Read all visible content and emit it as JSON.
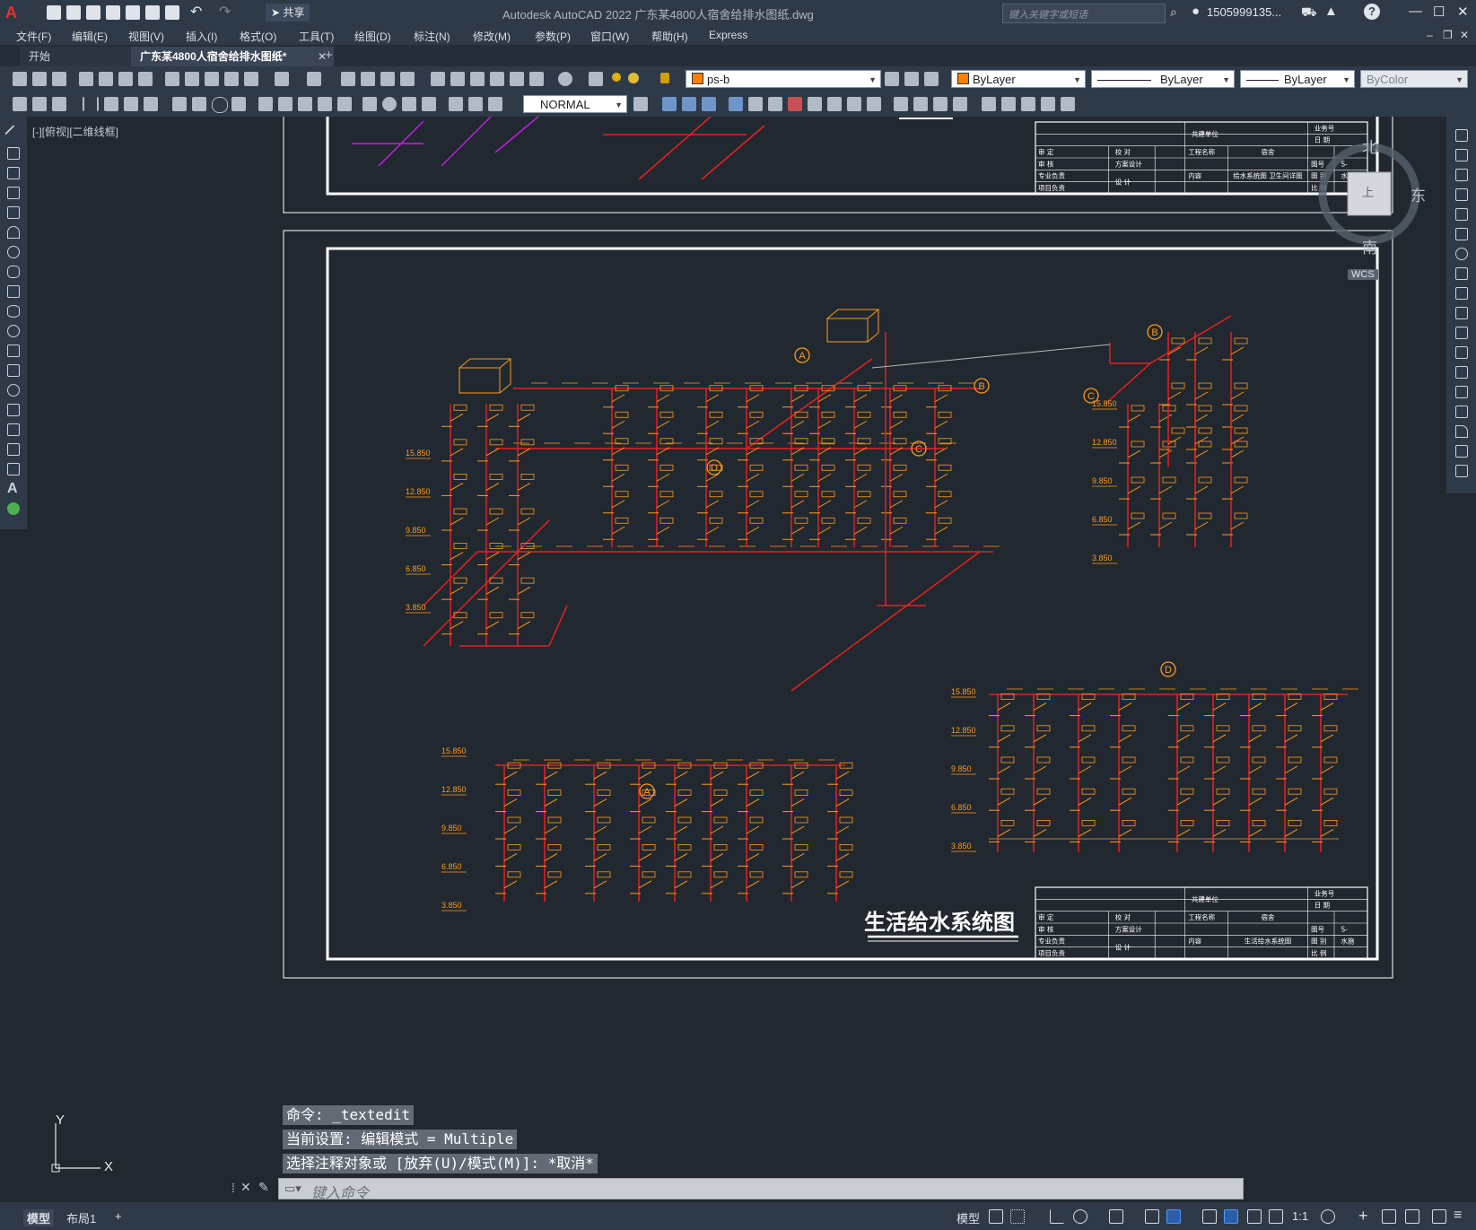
{
  "app": {
    "title": "Autodesk AutoCAD 2022    广东某4800人宿舍给排水图纸.dwg",
    "share_label": "共享",
    "search_placeholder": "键入关键字或短语",
    "user": "1505999135...",
    "help": "?"
  },
  "menu": [
    "文件(F)",
    "编辑(E)",
    "视图(V)",
    "插入(I)",
    "格式(O)",
    "工具(T)",
    "绘图(D)",
    "标注(N)",
    "修改(M)",
    "参数(P)",
    "窗口(W)",
    "帮助(H)",
    "Express"
  ],
  "tabs": {
    "start": "开始",
    "drawing": "广东某4800人宿舍给排水图纸*",
    "close": "✕",
    "add": "+"
  },
  "toolbar": {
    "layer": "ps-b",
    "color": "ByLayer",
    "linetype": "ByLayer",
    "lineweight": "ByLayer",
    "plotstyle": "ByColor",
    "text_style": "NORMAL"
  },
  "viewport": {
    "label": "[-][俯视][二维线框]"
  },
  "viewcube": {
    "north": "北",
    "east": "东",
    "south": "南",
    "top": "上",
    "wcs": "WCS"
  },
  "drawing": {
    "main_title": "生活给水系统图",
    "elevations": [
      "15.850",
      "12.850",
      "9.850",
      "6.850",
      "3.850"
    ],
    "markers": [
      "A",
      "B",
      "C",
      "D"
    ],
    "title_block": {
      "build_unit": "共建单位",
      "project_name_label": "工程名称",
      "project_name": "宿舍",
      "content_label": "内容",
      "content_top": "给水系统图 卫生间详图",
      "content_bottom": "生活给水系统图",
      "drawing_no_label": "图号",
      "drawing_no": "S-",
      "rows": [
        "审  定",
        "审  核",
        "专业负责",
        "项目负责"
      ],
      "design_labels": [
        "校  对",
        "方案设计",
        "设  计"
      ],
      "right_labels": [
        "业务号",
        "日  期",
        "图  别",
        "比  例"
      ],
      "category": "水施"
    }
  },
  "command": {
    "history": [
      "命令: _textedit",
      "当前设置: 编辑模式 = Multiple",
      "选择注释对象或 [放弃(U)/模式(M)]: *取消*"
    ],
    "placeholder": "键入命令"
  },
  "status": {
    "model_tab": "模型",
    "layout_tab": "布局1",
    "add": "+",
    "model_space": "模型",
    "scale": "1:1"
  },
  "ucs": {
    "x": "X",
    "y": "Y"
  },
  "colors": {
    "pipe": "#e8211f",
    "annotation": "#ff9a1a",
    "purple_pipe": "#c020e0",
    "frame": "#ffffff",
    "background": "#212830"
  }
}
